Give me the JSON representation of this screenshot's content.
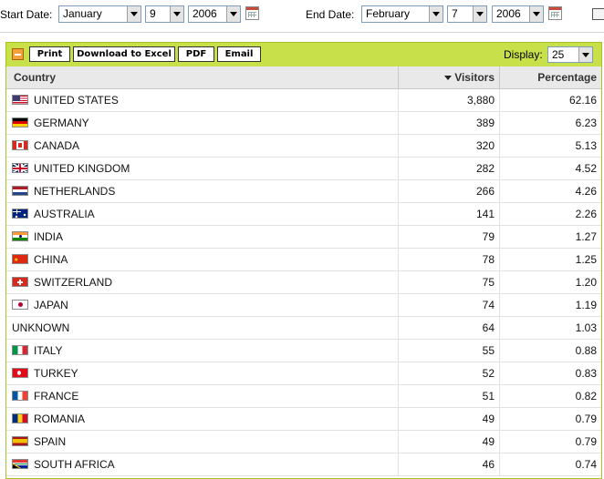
{
  "date_filter": {
    "start_label": "Start Date:",
    "start_month": "January",
    "start_day": "9",
    "start_year": "2006",
    "end_label": "End Date:",
    "end_month": "February",
    "end_day": "7",
    "end_year": "2006"
  },
  "toolbar": {
    "print_label": "Print",
    "excel_label": "Download to Excel",
    "pdf_label": "PDF",
    "email_label": "Email",
    "display_label": "Display:",
    "display_value": "25"
  },
  "table": {
    "columns": [
      "Country",
      "Visitors",
      "Percentage"
    ],
    "sorted_by": "Visitors",
    "sort_direction": "descending",
    "rows": [
      {
        "flag": "us-flag-icon",
        "country": "UNITED STATES",
        "visitors": "3,880",
        "percentage": "62.16"
      },
      {
        "flag": "de-flag-icon",
        "country": "GERMANY",
        "visitors": "389",
        "percentage": "6.23"
      },
      {
        "flag": "ca-flag-icon",
        "country": "CANADA",
        "visitors": "320",
        "percentage": "5.13"
      },
      {
        "flag": "gb-flag-icon",
        "country": "UNITED KINGDOM",
        "visitors": "282",
        "percentage": "4.52"
      },
      {
        "flag": "nl-flag-icon",
        "country": "NETHERLANDS",
        "visitors": "266",
        "percentage": "4.26"
      },
      {
        "flag": "au-flag-icon",
        "country": "AUSTRALIA",
        "visitors": "141",
        "percentage": "2.26"
      },
      {
        "flag": "in-flag-icon",
        "country": "INDIA",
        "visitors": "79",
        "percentage": "1.27"
      },
      {
        "flag": "cn-flag-icon",
        "country": "CHINA",
        "visitors": "78",
        "percentage": "1.25"
      },
      {
        "flag": "ch-flag-icon",
        "country": "SWITZERLAND",
        "visitors": "75",
        "percentage": "1.20"
      },
      {
        "flag": "jp-flag-icon",
        "country": "JAPAN",
        "visitors": "74",
        "percentage": "1.19"
      },
      {
        "flag": "",
        "country": "UNKNOWN",
        "visitors": "64",
        "percentage": "1.03"
      },
      {
        "flag": "it-flag-icon",
        "country": "ITALY",
        "visitors": "55",
        "percentage": "0.88"
      },
      {
        "flag": "tr-flag-icon",
        "country": "TURKEY",
        "visitors": "52",
        "percentage": "0.83"
      },
      {
        "flag": "fr-flag-icon",
        "country": "FRANCE",
        "visitors": "51",
        "percentage": "0.82"
      },
      {
        "flag": "ro-flag-icon",
        "country": "ROMANIA",
        "visitors": "49",
        "percentage": "0.79"
      },
      {
        "flag": "es-flag-icon",
        "country": "SPAIN",
        "visitors": "49",
        "percentage": "0.79"
      },
      {
        "flag": "za-flag-icon",
        "country": "SOUTH AFRICA",
        "visitors": "46",
        "percentage": "0.74"
      }
    ]
  },
  "colors": {
    "toolbar_green": "#c8e04a",
    "panel_border": "#a6c423",
    "header_gray": "#e9e9e9"
  }
}
